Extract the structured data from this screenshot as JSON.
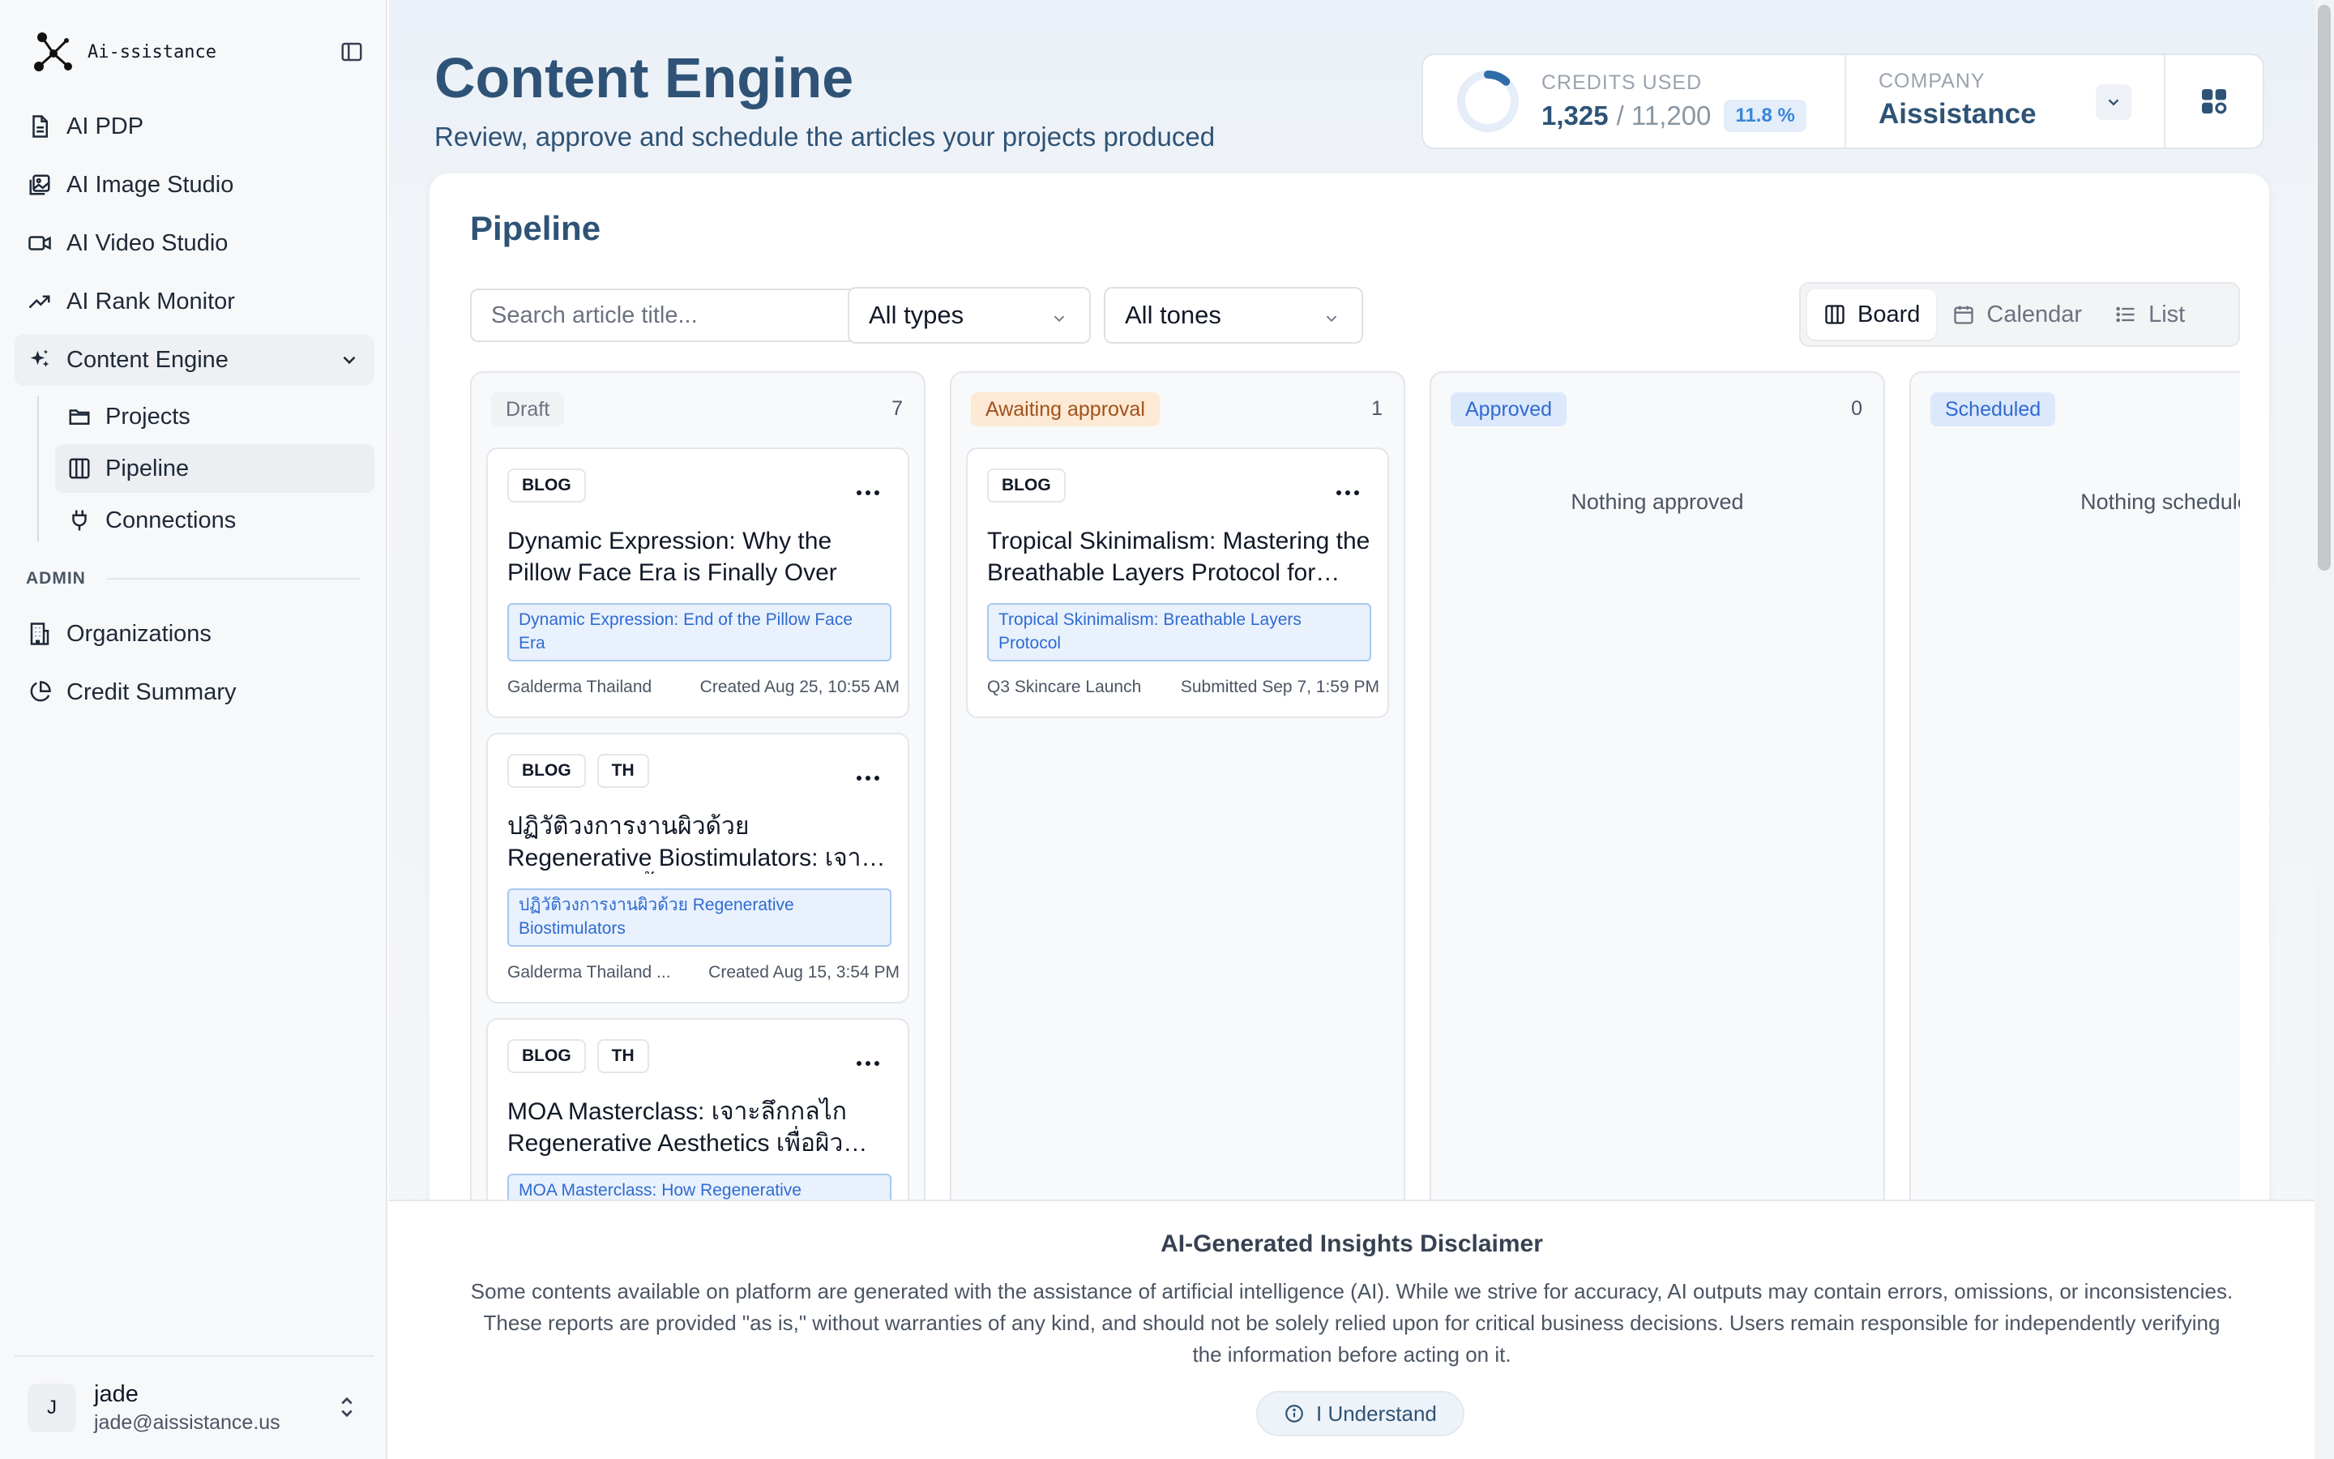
{
  "brand": {
    "name": "Ai-ssistance"
  },
  "sidebar": {
    "nav": [
      {
        "label": "AI PDP",
        "icon": "document-icon"
      },
      {
        "label": "AI Image Studio",
        "icon": "image-icon"
      },
      {
        "label": "AI Video Studio",
        "icon": "video-icon"
      },
      {
        "label": "AI Rank Monitor",
        "icon": "trending-icon"
      },
      {
        "label": "Content Engine",
        "icon": "sparkles-icon",
        "expanded": true
      }
    ],
    "sub_nav": [
      {
        "label": "Projects",
        "icon": "folder-icon"
      },
      {
        "label": "Pipeline",
        "icon": "columns-icon",
        "active": true
      },
      {
        "label": "Connections",
        "icon": "plug-icon"
      }
    ],
    "admin_label": "ADMIN",
    "admin": [
      {
        "label": "Organizations",
        "icon": "building-icon"
      },
      {
        "label": "Credit Summary",
        "icon": "pie-chart-icon"
      }
    ],
    "user": {
      "initial": "J",
      "name": "jade",
      "email": "jade@aissistance.us"
    }
  },
  "header": {
    "title": "Content Engine",
    "subtitle": "Review, approve and schedule the articles your projects produced"
  },
  "stats": {
    "credits_label": "CREDITS USED",
    "credits_used": "1,325",
    "credits_total": "/ 11,200",
    "credits_percent": "11.8 %",
    "credits_fraction": 0.118,
    "company_label": "COMPANY",
    "company_name": "Aissistance"
  },
  "pipeline": {
    "title": "Pipeline",
    "search_placeholder": "Search article title...",
    "type_filter": "All types",
    "tone_filter": "All tones",
    "views": [
      "Board",
      "Calendar",
      "List"
    ],
    "active_view": "Board",
    "columns": [
      {
        "name": "Draft",
        "count": "7",
        "tag_bg": "#f1f2f4",
        "tag_color": "#6b7280",
        "cards": [
          {
            "tags": [
              "BLOG"
            ],
            "title": "Dynamic Expression: Why the Pillow Face Era is Finally Over",
            "project": "Dynamic Expression: End of the Pillow Face Era",
            "source": "Galderma Thailand",
            "date": "Created Aug 25, 10:55 AM"
          },
          {
            "tags": [
              "BLOG",
              "TH"
            ],
            "title": "ปฏิวัติวงการงานผิวด้วย Regenerative Biostimulators: เจาะลึกนวัตกรรมฟื้นฟูผิว",
            "project": "ปฏิวัติวงการงานผิวด้วย Regenerative Biostimulators",
            "source": "Galderma Thailand ...",
            "date": "Created Aug 15, 3:54 PM"
          },
          {
            "tags": [
              "BLOG",
              "TH"
            ],
            "title": "MOA Masterclass: เจาะลึกกลไก Regenerative Aesthetics เพื่อผิวสุขภาพดี",
            "project": "MOA Masterclass: How Regenerative",
            "source": "",
            "date": ""
          }
        ]
      },
      {
        "name": "Awaiting approval",
        "count": "1",
        "tag_bg": "#fde9d4",
        "tag_color": "#a0521c",
        "cards": [
          {
            "tags": [
              "BLOG"
            ],
            "title": "Tropical Skinimalism: Mastering the Breathable Layers Protocol for Humid Climates",
            "project": "Tropical Skinimalism: Breathable Layers Protocol",
            "source": "Q3 Skincare Launch",
            "date": "Submitted Sep 7, 1:59 PM"
          }
        ]
      },
      {
        "name": "Approved",
        "count": "0",
        "tag_bg": "#dce8fb",
        "tag_color": "#2f6bd1",
        "empty": "Nothing approved",
        "cards": []
      },
      {
        "name": "Scheduled",
        "count": "",
        "tag_bg": "#dce8fb",
        "tag_color": "#2f6bd1",
        "empty": "Nothing scheduled",
        "cards": []
      }
    ]
  },
  "disclaimer": {
    "title": "AI-Generated Insights Disclaimer",
    "body": "Some contents available on platform are generated with the assistance of artificial intelligence (AI). While we strive for accuracy, AI outputs may contain errors, omissions, or inconsistencies. These reports are provided \"as is,\" without warranties of any kind, and should not be solely relied upon for critical business decisions. Users remain responsible for independently verifying the information before acting on it.",
    "button": "I Understand"
  }
}
